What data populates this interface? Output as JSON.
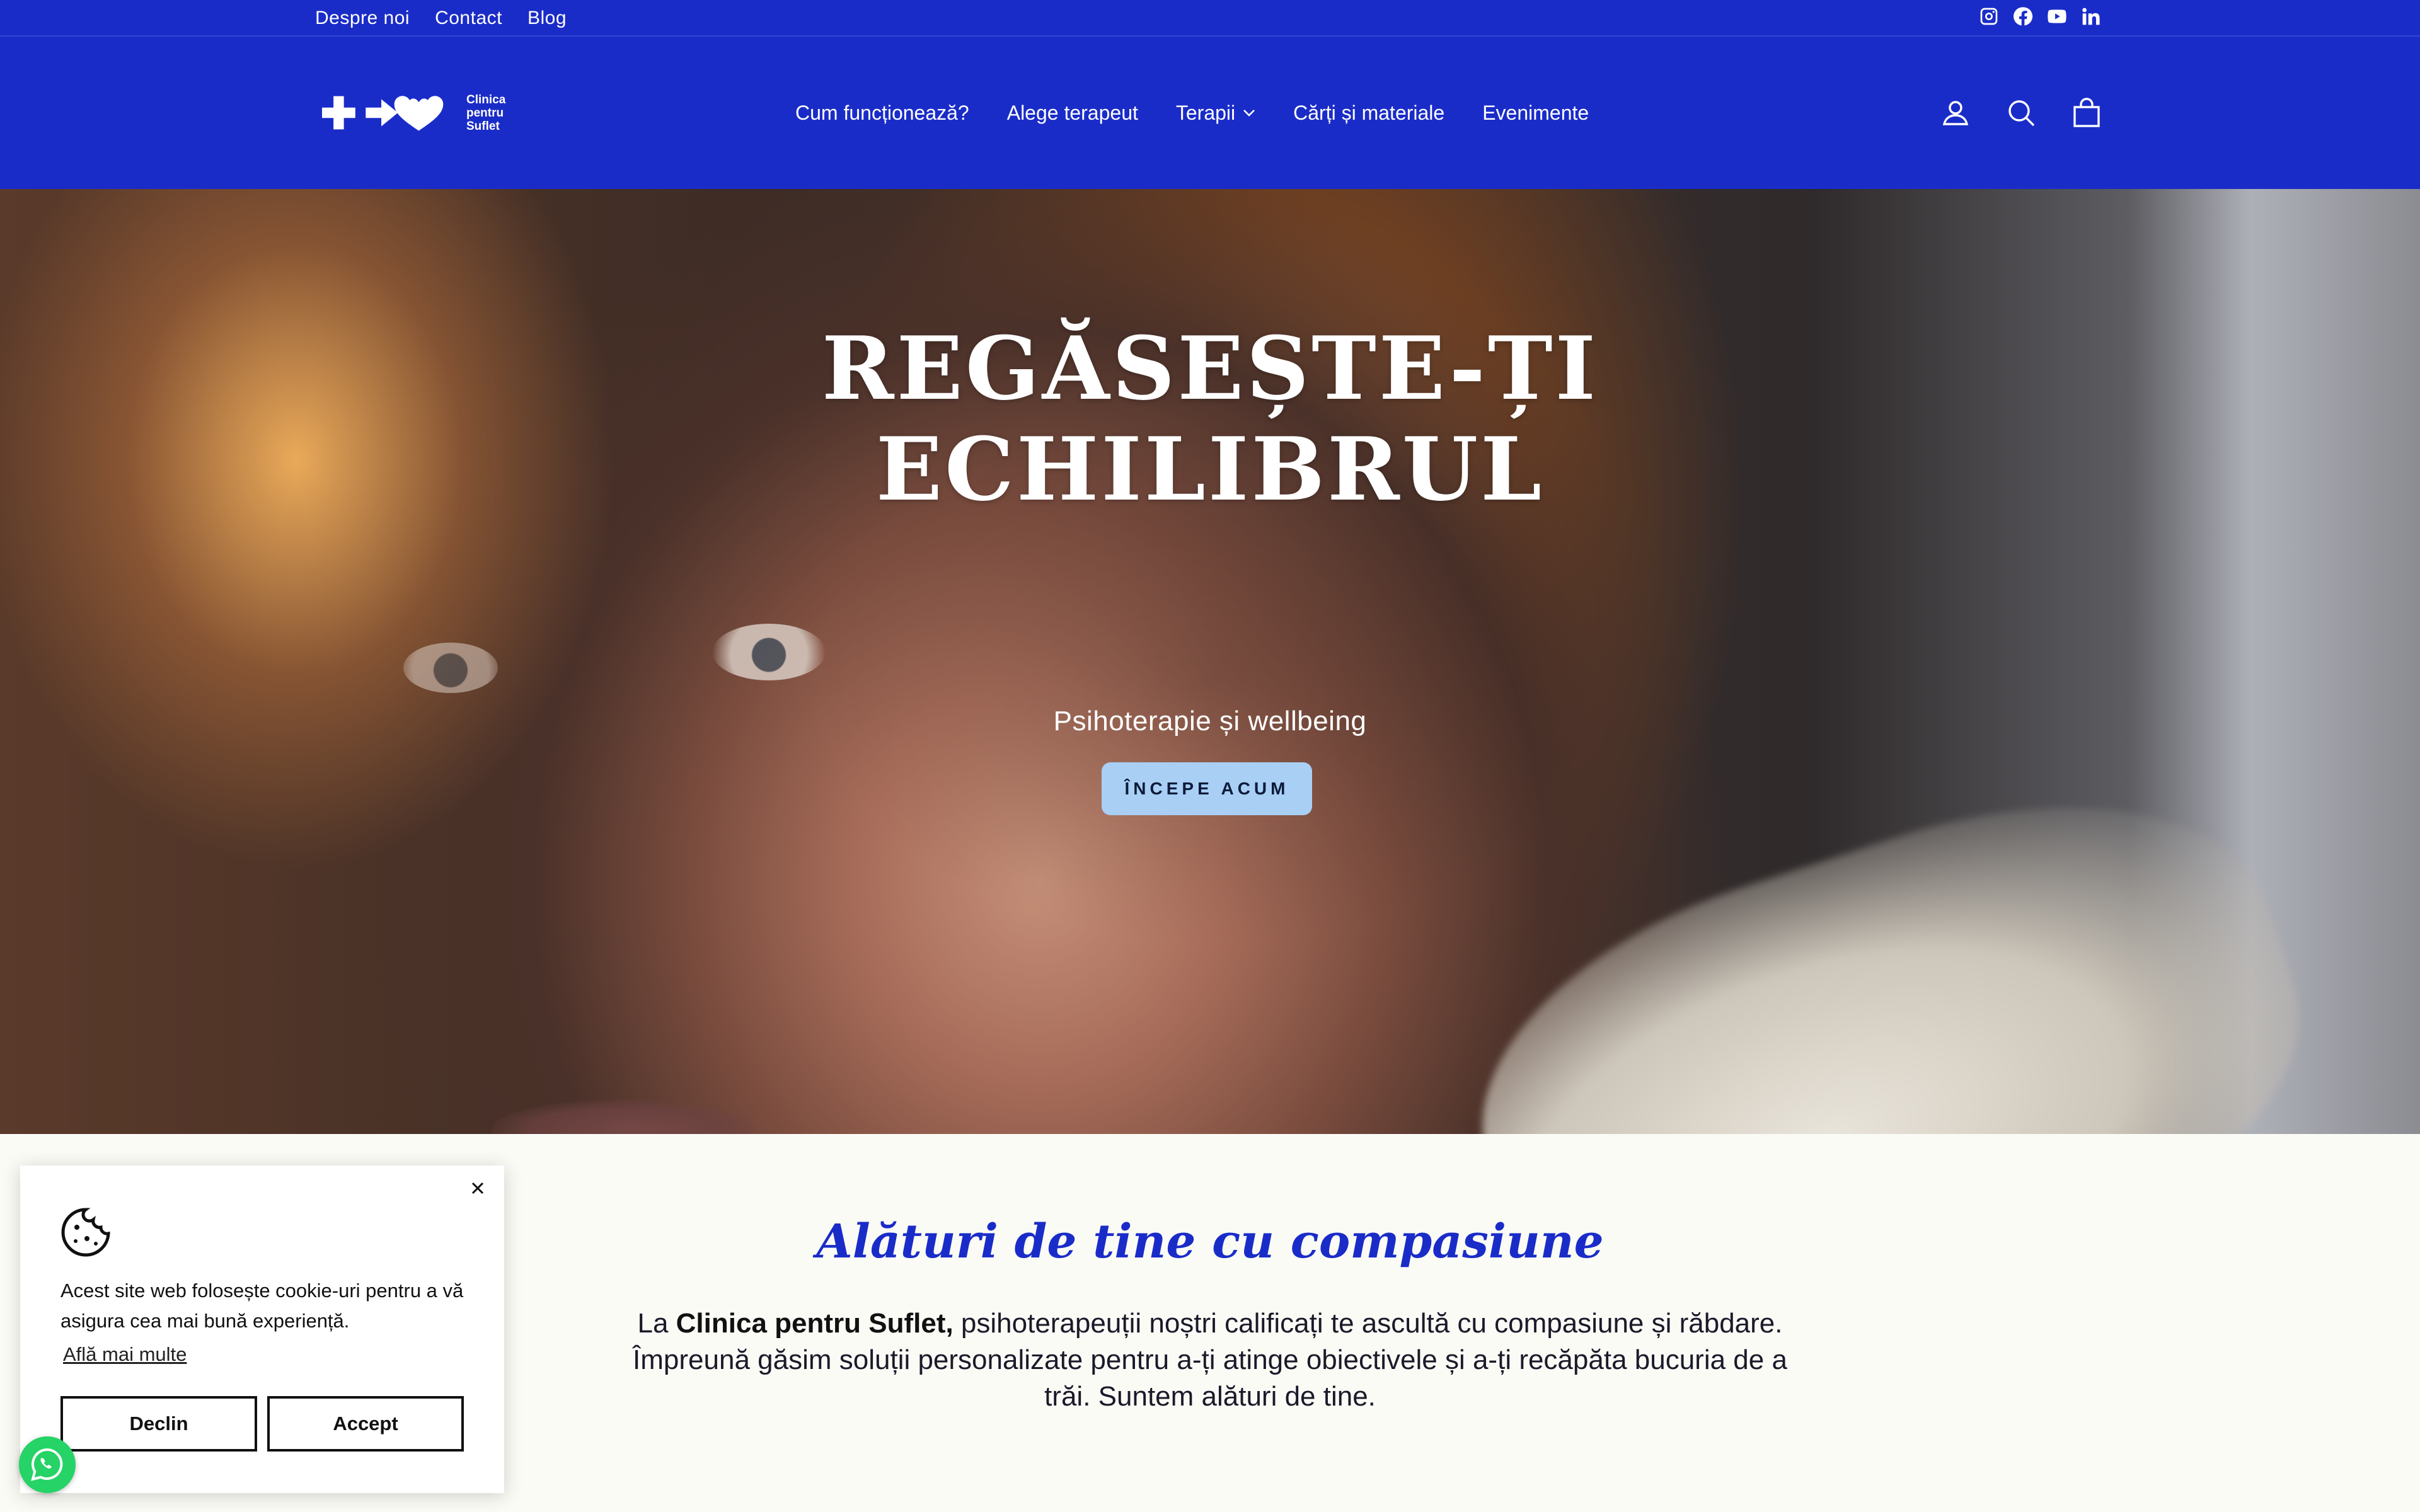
{
  "topbar": {
    "links": [
      "Despre noi",
      "Contact",
      "Blog"
    ],
    "social": [
      "instagram-icon",
      "facebook-icon",
      "youtube-icon",
      "linkedin-icon"
    ]
  },
  "brand": {
    "logo_lines": [
      "Clinica",
      "pentru",
      "Suflet"
    ],
    "primary_color": "#1a2cc8"
  },
  "nav": {
    "items": [
      "Cum funcționează?",
      "Alege terapeut",
      "Terapii",
      "Cărți și materiale",
      "Evenimente"
    ],
    "dropdown_item": "Terapii"
  },
  "header_icons": [
    "account-icon",
    "search-icon",
    "cart-icon"
  ],
  "hero": {
    "title_line1": "REGĂSEȘTE-ȚI",
    "title_line2": "ECHILIBRUL",
    "subtitle": "Psihoterapie și wellbeing",
    "cta_label": "ÎNCEPE ACUM",
    "cta_color": "#a9cff5"
  },
  "intro": {
    "title": "Alături de tine cu compasiune",
    "text_prefix": "La ",
    "text_bold": "Clinica pentru Suflet,",
    "text_rest": " psihoterapeuții noștri calificați te ascultă cu compasiune și răbdare. Împreună găsim soluții personalizate pentru a-ți atinge obiectivele și a-ți recăpăta bucuria de a trăi. Suntem alături de tine."
  },
  "cookie": {
    "text": "Acest site web folosește cookie-uri pentru a vă asigura cea mai bună experiență.",
    "learn_more": "Află mai multe",
    "decline_label": "Declin",
    "accept_label": "Accept"
  },
  "whatsapp": {
    "icon": "whatsapp-icon",
    "color": "#25d366"
  }
}
